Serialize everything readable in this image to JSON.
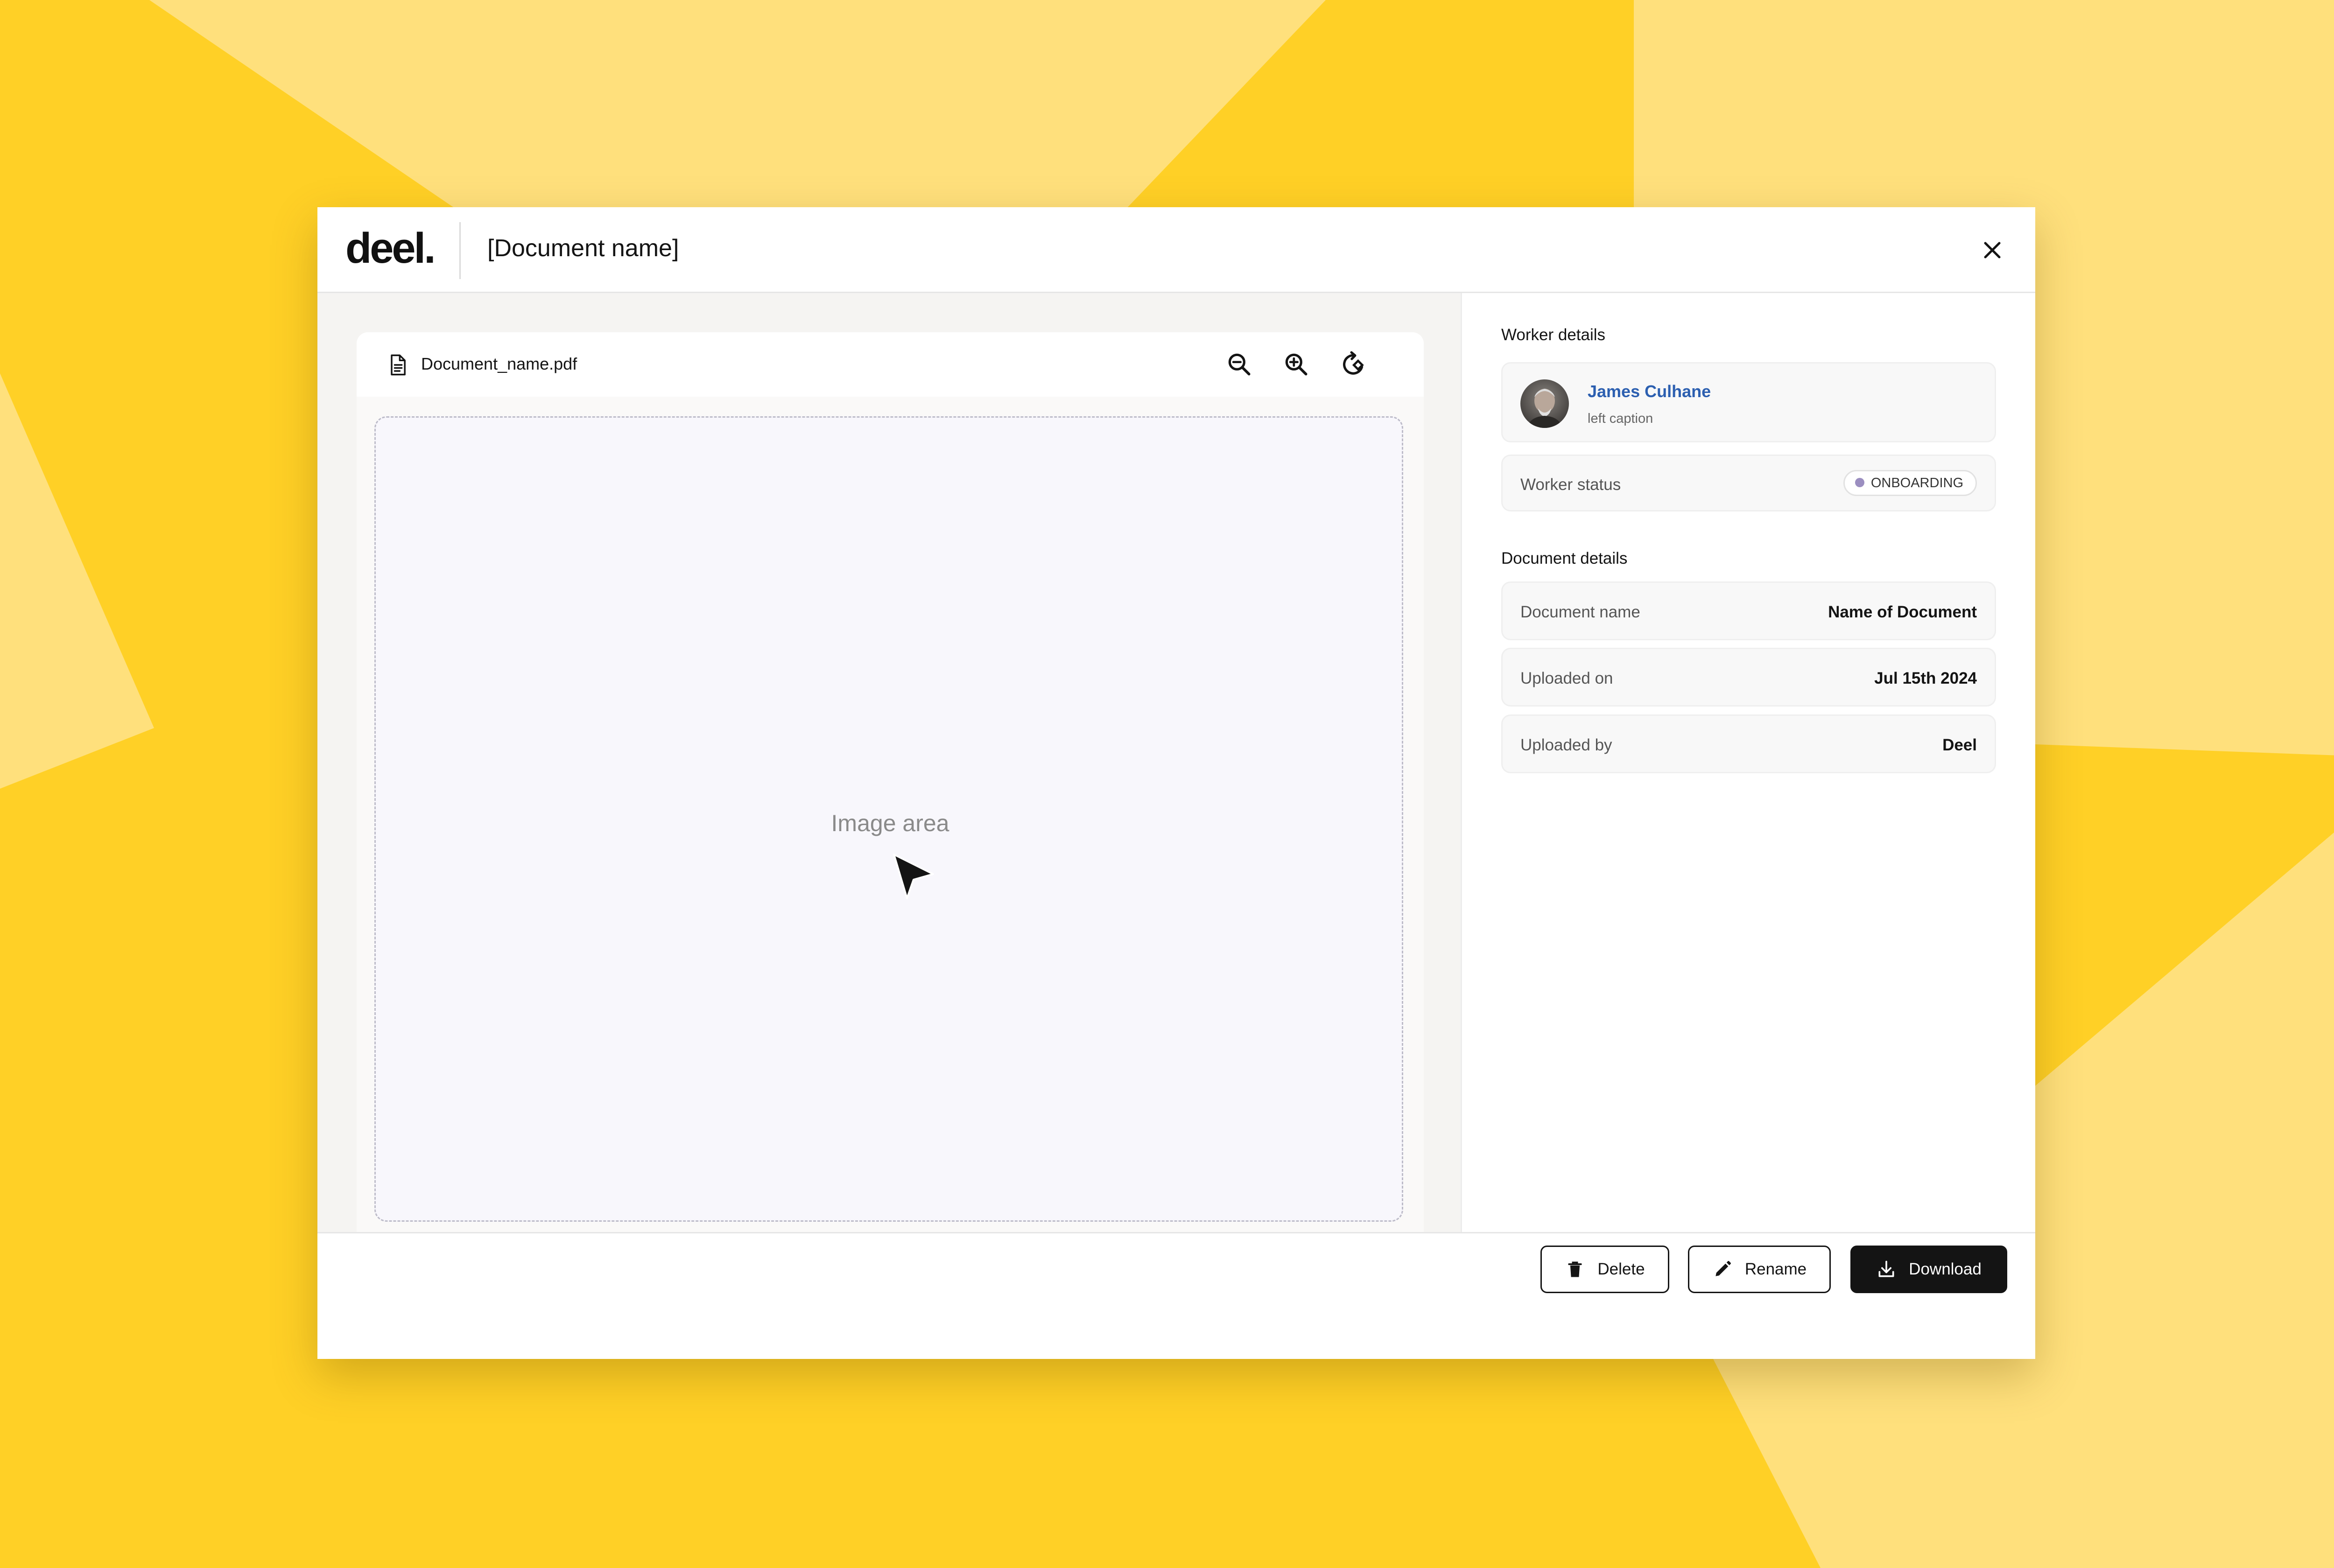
{
  "brand": {
    "logo_text": "deel."
  },
  "colors": {
    "background": "#FFD026",
    "background_light": "#FFE07C",
    "accent_link": "#2C5FB0",
    "primary_button": "#141414",
    "status_dot": "#9B8EC0"
  },
  "header": {
    "title": "[Document name]",
    "close_icon": "close-icon"
  },
  "viewer": {
    "file_icon": "file-icon",
    "file_name": "Document_name.pdf",
    "tools": [
      "zoom-out-icon",
      "zoom-in-icon",
      "rotate-icon"
    ],
    "placeholder_label": "Image area",
    "cursor_icon": "cursor-icon"
  },
  "worker_details": {
    "section_title": "Worker details",
    "worker": {
      "name": "James Culhane",
      "caption": "left caption",
      "avatar_icon": "avatar"
    },
    "status": {
      "label": "Worker status",
      "value": "ONBOARDING"
    }
  },
  "document_details": {
    "section_title": "Document details",
    "rows": [
      {
        "label": "Document name",
        "value": "Name of Document"
      },
      {
        "label": "Uploaded on",
        "value": "Jul 15th 2024"
      },
      {
        "label": "Uploaded by",
        "value": "Deel"
      }
    ]
  },
  "footer": {
    "delete_label": "Delete",
    "delete_icon": "trash-icon",
    "rename_label": "Rename",
    "rename_icon": "pencil-icon",
    "download_label": "Download",
    "download_icon": "download-icon"
  }
}
